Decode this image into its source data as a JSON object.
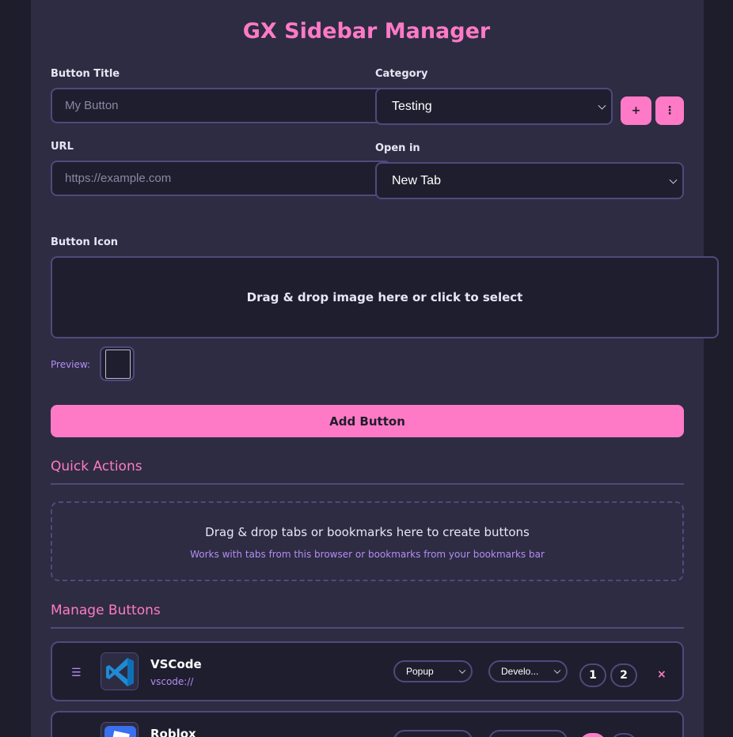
{
  "header": {
    "title": "GX Sidebar Manager"
  },
  "form": {
    "button_title_label": "Button Title",
    "button_title_placeholder": "My Button",
    "category_label": "Category",
    "category_value": "Testing",
    "add_category_label": "+",
    "category_menu_label": "⋮",
    "url_label": "URL",
    "url_placeholder": "https://example.com",
    "open_in_label": "Open in",
    "open_in_value": "New Tab",
    "icon_label": "Button Icon",
    "icon_dropzone_text": "Drag & drop image here or click to select",
    "preview_label": "Preview:",
    "add_button_label": "Add Button"
  },
  "quick_actions": {
    "title": "Quick Actions",
    "main_text": "Drag & drop tabs or bookmarks here to create buttons",
    "sub_text": "Works with tabs from this browser or bookmarks from your bookmarks bar"
  },
  "manage": {
    "title": "Manage Buttons",
    "rows": [
      {
        "handle": "☰",
        "icon": "vscode-icon",
        "name": "VSCode",
        "url": "vscode://",
        "open_in": "Popup",
        "category": "Develo...",
        "pos1": "1",
        "pos2": "2",
        "delete": "×"
      },
      {
        "icon": "roblox-icon",
        "name": "Roblox"
      }
    ]
  },
  "colors": {
    "accent": "#ff7ac6",
    "panel": "#2d2c42",
    "border": "#4e4a7c",
    "link": "#b48cf5"
  }
}
